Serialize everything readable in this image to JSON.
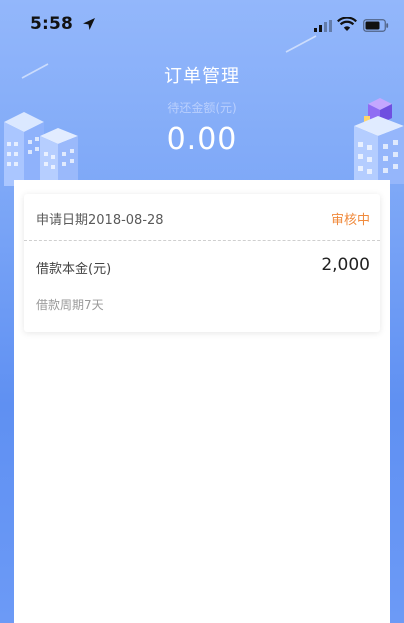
{
  "status_bar": {
    "time": "5:58",
    "icons": [
      "location-arrow-icon",
      "signal-icon",
      "wifi-icon",
      "battery-icon"
    ]
  },
  "header": {
    "title": "订单管理",
    "amount_label": "待还金额(元)",
    "amount_value": "0.00"
  },
  "order": {
    "apply_date_label": "申请日期2018-08-28",
    "status": "审核中",
    "principal_label": "借款本金(元)",
    "principal_value": "2,000",
    "term_label": "借款周期7天"
  },
  "colors": {
    "status_accent": "#f08a3c",
    "header_gradient_top": "#93b7fb",
    "header_gradient_bottom": "#5f90f2"
  }
}
